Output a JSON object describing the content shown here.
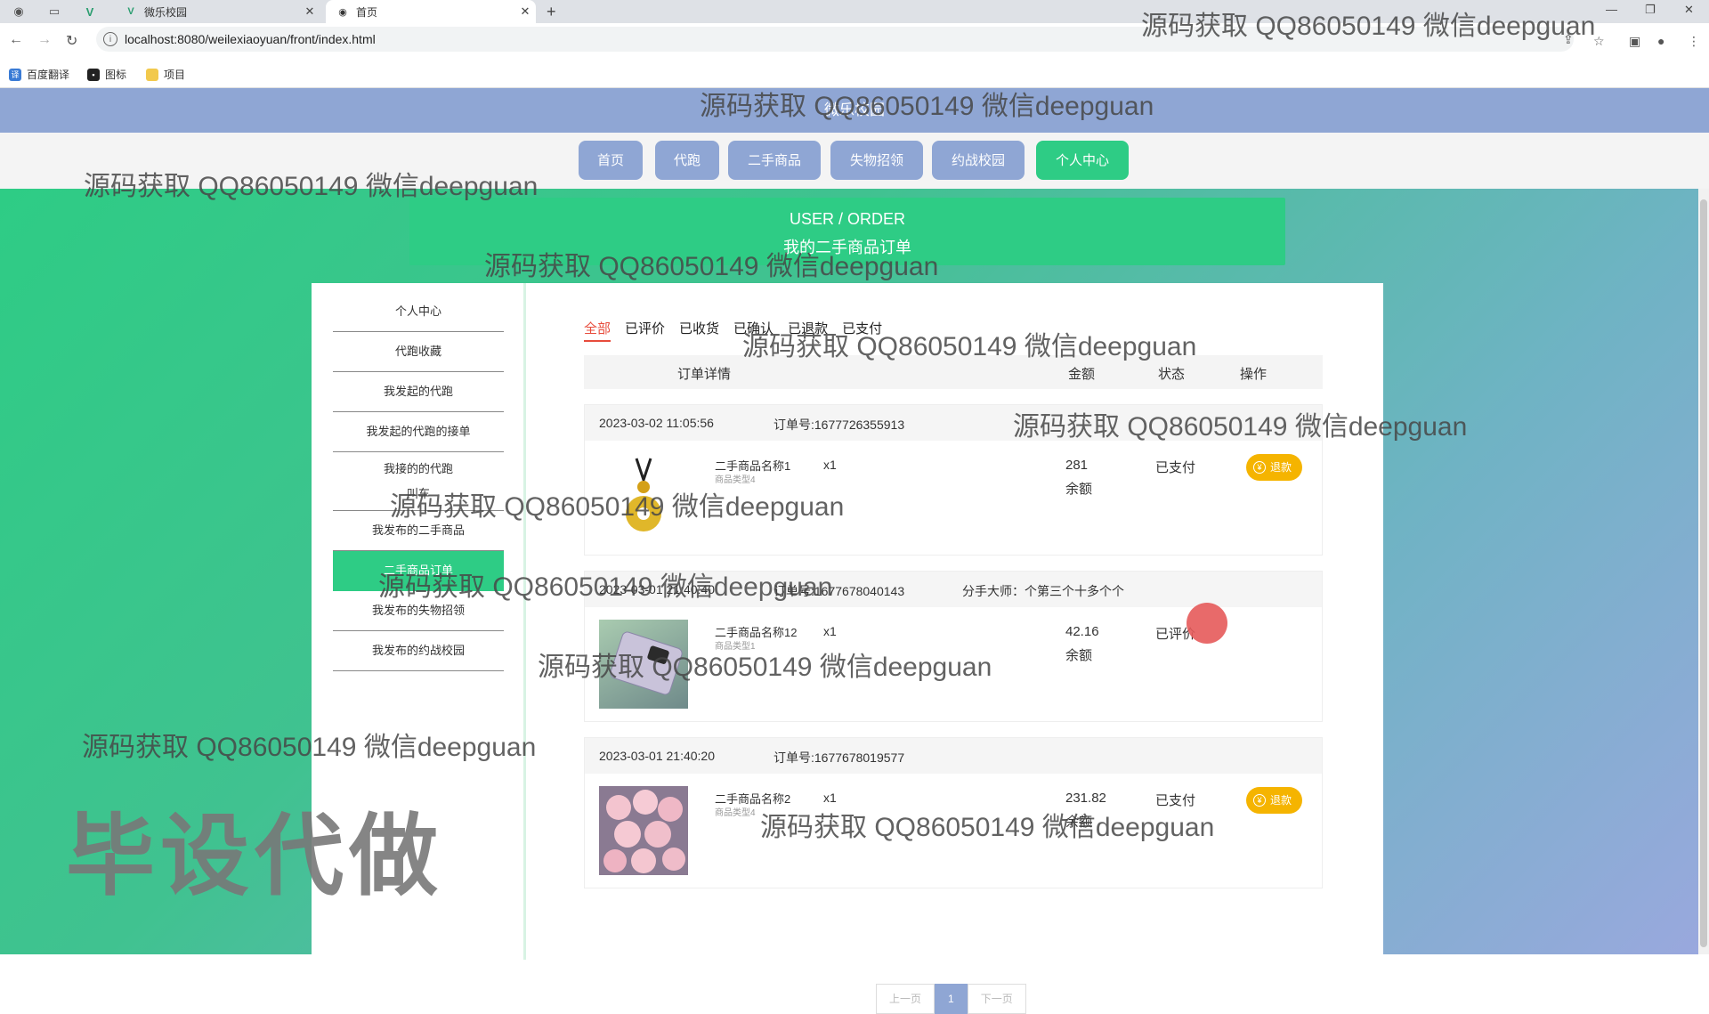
{
  "browser": {
    "tab_inactive": "微乐校园",
    "tab_active": "首页",
    "url": "localhost:8080/weilexiaoyuan/front/index.html",
    "bookmarks": [
      "百度翻译",
      "图标",
      "项目"
    ]
  },
  "site": {
    "title": "微乐校园",
    "nav": [
      "首页",
      "代跑",
      "二手商品",
      "失物招领",
      "约战校园",
      "个人中心"
    ],
    "banner_en": "USER / ORDER",
    "banner_cn": "我的二手商品订单"
  },
  "sidebar": {
    "items": [
      "个人中心",
      "代跑收藏",
      "我发起的代跑",
      "我发起的代跑的接单",
      "我接的的代跑",
      "叫车",
      "我发布的二手商品",
      "二手商品订单",
      "我发布的失物招领",
      "我发布的约战校园"
    ]
  },
  "status_tabs": [
    "全部",
    "已评价",
    "已收货",
    "已确认",
    "已退款",
    "已支付"
  ],
  "table_headers": [
    "订单详情",
    "金额",
    "状态",
    "操作"
  ],
  "orders": [
    {
      "time": "2023-03-02 11:05:56",
      "order_no": "订单号:1677726355913",
      "note": "",
      "name": "二手商品名称1",
      "type": "商品类型4",
      "qty": "x1",
      "amount": "281",
      "pay": "余额",
      "status": "已支付",
      "action": "退款"
    },
    {
      "time": "2023-03-01 21:40:40",
      "order_no": "订单号:1677678040143",
      "note": "分手大师：个第三个十多个个",
      "name": "二手商品名称12",
      "type": "商品类型1",
      "qty": "x1",
      "amount": "42.16",
      "pay": "余额",
      "status": "已评价",
      "action": ""
    },
    {
      "time": "2023-03-01 21:40:20",
      "order_no": "订单号:1677678019577",
      "note": "",
      "name": "二手商品名称2",
      "type": "商品类型4",
      "qty": "x1",
      "amount": "231.82",
      "pay": "余额",
      "status": "已支付",
      "action": "退款"
    }
  ],
  "pager": {
    "prev": "上一页",
    "current": "1",
    "next": "下一页"
  },
  "watermark": "源码获取 QQ86050149 微信deepguan",
  "big_watermark": "毕设代做",
  "colors": {
    "primary_green": "#2ecc85",
    "nav_blue": "#8fa6d4",
    "refund_yellow": "#f5b400",
    "active_red": "#e74c3c"
  }
}
